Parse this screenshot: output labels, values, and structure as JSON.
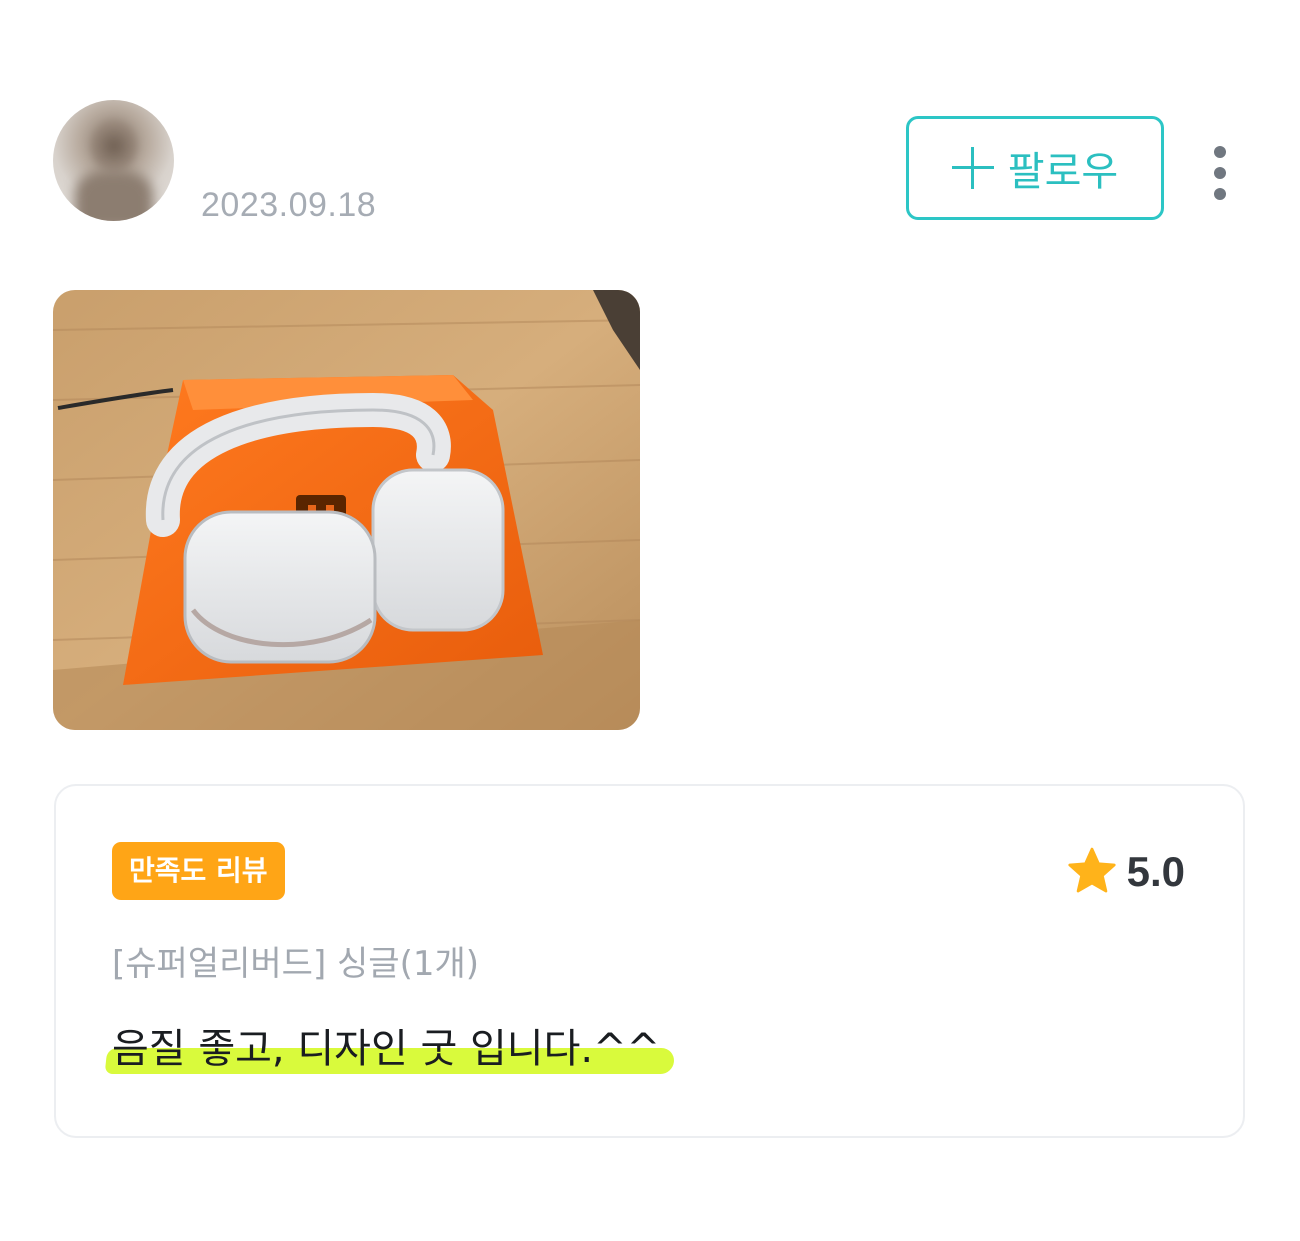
{
  "review": {
    "date": "2023.09.18",
    "follow_label": "팔로우",
    "badge": "만족도 리뷰",
    "rating": "5.0",
    "option": "[슈퍼얼리버드] 싱글(1개)",
    "text": "음질 좋고, 디자인 굿 입니다.^^"
  },
  "icons": {
    "follow": "plus-icon",
    "more": "more-vertical-icon",
    "rating": "star-icon"
  },
  "colors": {
    "accent": "#2cc6c6",
    "badge": "#ffa516",
    "star": "#ffb31a",
    "highlight": "#d9fa3c"
  }
}
